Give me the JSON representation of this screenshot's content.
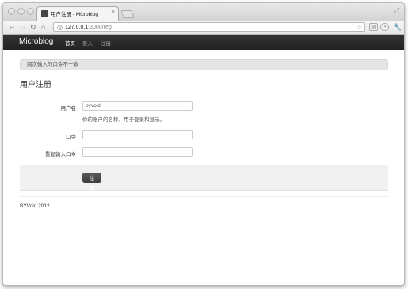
{
  "browser": {
    "tab_title": "用户注册 - Microblog",
    "tab_close": "×",
    "url_host": "127.0.0.1",
    "url_path": ":3000/reg"
  },
  "navbar": {
    "brand": "Microblog",
    "items": [
      {
        "label": "首页",
        "active": true
      },
      {
        "label": "登入",
        "active": false
      },
      {
        "label": "注册",
        "active": false
      }
    ]
  },
  "alert": {
    "message": "两次输入的口令不一致"
  },
  "form": {
    "legend": "用户注册",
    "username_label": "用户名",
    "username_value": "byvoid",
    "username_help": "你的账户的名称，用于登录和显示。",
    "password_label": "口令",
    "password_value": "",
    "repeat_label": "重复输入口令",
    "repeat_value": "",
    "submit_label": "注册"
  },
  "footer": {
    "text": "BYVoid 2012"
  }
}
